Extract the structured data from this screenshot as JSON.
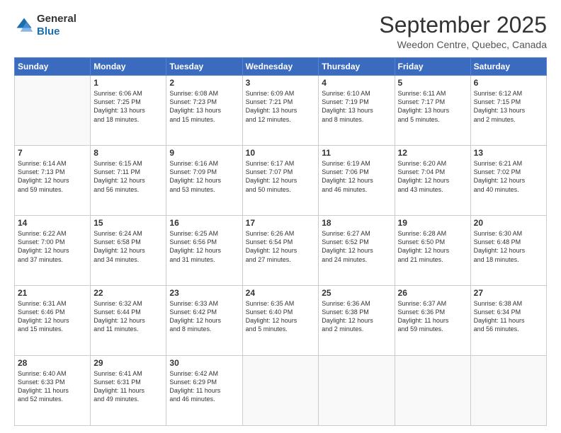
{
  "header": {
    "logo_line1": "General",
    "logo_line2": "Blue",
    "main_title": "September 2025",
    "subtitle": "Weedon Centre, Quebec, Canada"
  },
  "weekdays": [
    "Sunday",
    "Monday",
    "Tuesday",
    "Wednesday",
    "Thursday",
    "Friday",
    "Saturday"
  ],
  "weeks": [
    [
      {
        "day": "",
        "content": ""
      },
      {
        "day": "1",
        "content": "Sunrise: 6:06 AM\nSunset: 7:25 PM\nDaylight: 13 hours\nand 18 minutes."
      },
      {
        "day": "2",
        "content": "Sunrise: 6:08 AM\nSunset: 7:23 PM\nDaylight: 13 hours\nand 15 minutes."
      },
      {
        "day": "3",
        "content": "Sunrise: 6:09 AM\nSunset: 7:21 PM\nDaylight: 13 hours\nand 12 minutes."
      },
      {
        "day": "4",
        "content": "Sunrise: 6:10 AM\nSunset: 7:19 PM\nDaylight: 13 hours\nand 8 minutes."
      },
      {
        "day": "5",
        "content": "Sunrise: 6:11 AM\nSunset: 7:17 PM\nDaylight: 13 hours\nand 5 minutes."
      },
      {
        "day": "6",
        "content": "Sunrise: 6:12 AM\nSunset: 7:15 PM\nDaylight: 13 hours\nand 2 minutes."
      }
    ],
    [
      {
        "day": "7",
        "content": "Sunrise: 6:14 AM\nSunset: 7:13 PM\nDaylight: 12 hours\nand 59 minutes."
      },
      {
        "day": "8",
        "content": "Sunrise: 6:15 AM\nSunset: 7:11 PM\nDaylight: 12 hours\nand 56 minutes."
      },
      {
        "day": "9",
        "content": "Sunrise: 6:16 AM\nSunset: 7:09 PM\nDaylight: 12 hours\nand 53 minutes."
      },
      {
        "day": "10",
        "content": "Sunrise: 6:17 AM\nSunset: 7:07 PM\nDaylight: 12 hours\nand 50 minutes."
      },
      {
        "day": "11",
        "content": "Sunrise: 6:19 AM\nSunset: 7:06 PM\nDaylight: 12 hours\nand 46 minutes."
      },
      {
        "day": "12",
        "content": "Sunrise: 6:20 AM\nSunset: 7:04 PM\nDaylight: 12 hours\nand 43 minutes."
      },
      {
        "day": "13",
        "content": "Sunrise: 6:21 AM\nSunset: 7:02 PM\nDaylight: 12 hours\nand 40 minutes."
      }
    ],
    [
      {
        "day": "14",
        "content": "Sunrise: 6:22 AM\nSunset: 7:00 PM\nDaylight: 12 hours\nand 37 minutes."
      },
      {
        "day": "15",
        "content": "Sunrise: 6:24 AM\nSunset: 6:58 PM\nDaylight: 12 hours\nand 34 minutes."
      },
      {
        "day": "16",
        "content": "Sunrise: 6:25 AM\nSunset: 6:56 PM\nDaylight: 12 hours\nand 31 minutes."
      },
      {
        "day": "17",
        "content": "Sunrise: 6:26 AM\nSunset: 6:54 PM\nDaylight: 12 hours\nand 27 minutes."
      },
      {
        "day": "18",
        "content": "Sunrise: 6:27 AM\nSunset: 6:52 PM\nDaylight: 12 hours\nand 24 minutes."
      },
      {
        "day": "19",
        "content": "Sunrise: 6:28 AM\nSunset: 6:50 PM\nDaylight: 12 hours\nand 21 minutes."
      },
      {
        "day": "20",
        "content": "Sunrise: 6:30 AM\nSunset: 6:48 PM\nDaylight: 12 hours\nand 18 minutes."
      }
    ],
    [
      {
        "day": "21",
        "content": "Sunrise: 6:31 AM\nSunset: 6:46 PM\nDaylight: 12 hours\nand 15 minutes."
      },
      {
        "day": "22",
        "content": "Sunrise: 6:32 AM\nSunset: 6:44 PM\nDaylight: 12 hours\nand 11 minutes."
      },
      {
        "day": "23",
        "content": "Sunrise: 6:33 AM\nSunset: 6:42 PM\nDaylight: 12 hours\nand 8 minutes."
      },
      {
        "day": "24",
        "content": "Sunrise: 6:35 AM\nSunset: 6:40 PM\nDaylight: 12 hours\nand 5 minutes."
      },
      {
        "day": "25",
        "content": "Sunrise: 6:36 AM\nSunset: 6:38 PM\nDaylight: 12 hours\nand 2 minutes."
      },
      {
        "day": "26",
        "content": "Sunrise: 6:37 AM\nSunset: 6:36 PM\nDaylight: 11 hours\nand 59 minutes."
      },
      {
        "day": "27",
        "content": "Sunrise: 6:38 AM\nSunset: 6:34 PM\nDaylight: 11 hours\nand 56 minutes."
      }
    ],
    [
      {
        "day": "28",
        "content": "Sunrise: 6:40 AM\nSunset: 6:33 PM\nDaylight: 11 hours\nand 52 minutes."
      },
      {
        "day": "29",
        "content": "Sunrise: 6:41 AM\nSunset: 6:31 PM\nDaylight: 11 hours\nand 49 minutes."
      },
      {
        "day": "30",
        "content": "Sunrise: 6:42 AM\nSunset: 6:29 PM\nDaylight: 11 hours\nand 46 minutes."
      },
      {
        "day": "",
        "content": ""
      },
      {
        "day": "",
        "content": ""
      },
      {
        "day": "",
        "content": ""
      },
      {
        "day": "",
        "content": ""
      }
    ]
  ]
}
